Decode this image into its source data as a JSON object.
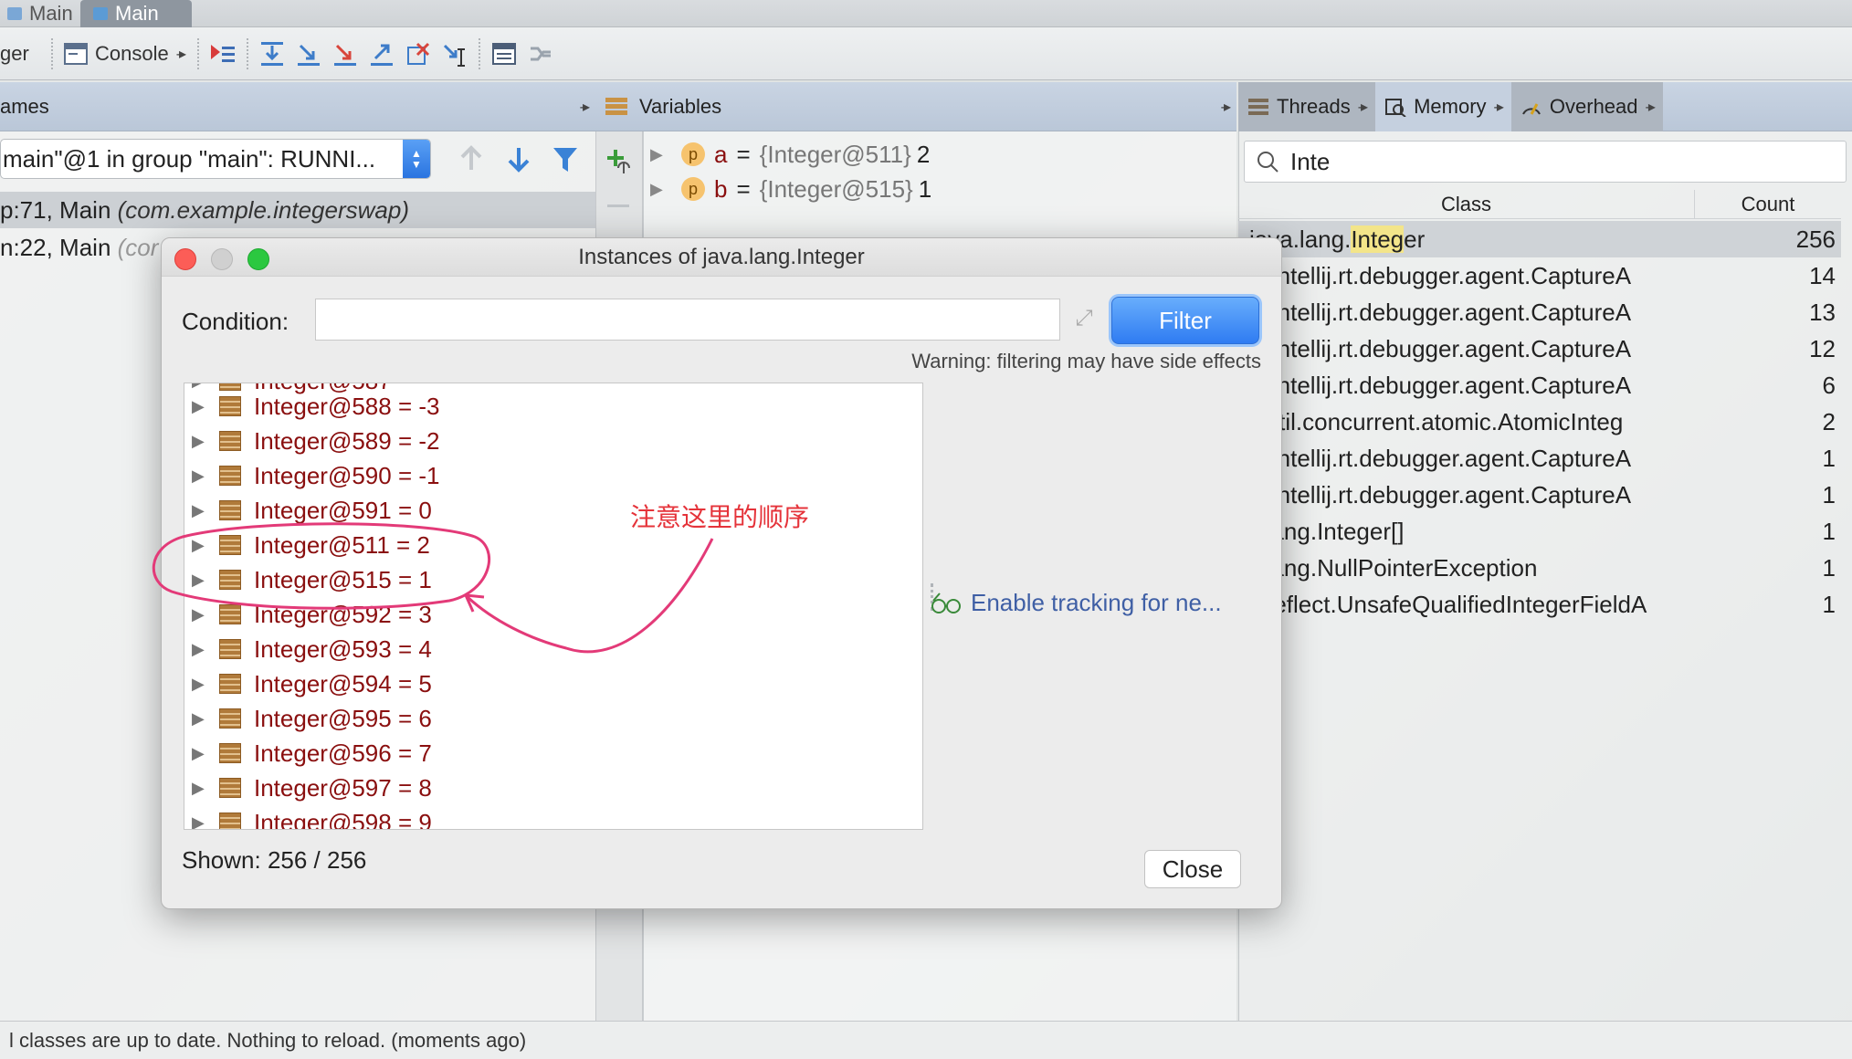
{
  "top_tabs": [
    {
      "label": "Main"
    },
    {
      "label": "Main"
    }
  ],
  "toolbar": {
    "debugger_label": "ger",
    "console_label": "Console"
  },
  "frames": {
    "header": "ames",
    "thread_select": "main\"@1 in group \"main\": RUNNI...",
    "rows": [
      {
        "method": "p:71, Main",
        "pkg": "(com.example.integerswap)"
      },
      {
        "method": "n:22, Main",
        "pkg": "(cor"
      }
    ]
  },
  "variables": {
    "header": "Variables",
    "rows": [
      {
        "badge": "p",
        "name": "a",
        "type": "{Integer@511}",
        "value": "2"
      },
      {
        "badge": "p",
        "name": "b",
        "type": "{Integer@515}",
        "value": "1"
      }
    ]
  },
  "memory": {
    "tabs": [
      "Threads",
      "Memory",
      "Overhead"
    ],
    "search_value": "Inte",
    "columns": [
      "Class",
      "Count"
    ],
    "rows": [
      {
        "pre": "java.lang.",
        "hl": "Integ",
        "post": "er",
        "count": "256"
      },
      {
        "cls": "m.intellij.rt.debugger.agent.CaptureA",
        "count": "14"
      },
      {
        "cls": "m.intellij.rt.debugger.agent.CaptureA",
        "count": "13"
      },
      {
        "cls": "m.intellij.rt.debugger.agent.CaptureA",
        "count": "12"
      },
      {
        "cls": "m.intellij.rt.debugger.agent.CaptureA",
        "count": "6"
      },
      {
        "cls": "a.util.concurrent.atomic.AtomicInteg",
        "count": "2"
      },
      {
        "cls": "m.intellij.rt.debugger.agent.CaptureA",
        "count": "1"
      },
      {
        "cls": "m.intellij.rt.debugger.agent.CaptureA",
        "count": "1"
      },
      {
        "cls": "a.lang.Integer[]",
        "count": "1"
      },
      {
        "cls": "a.lang.NullPointerException",
        "count": "1"
      },
      {
        "cls": "n.reflect.UnsafeQualifiedIntegerFieldA",
        "count": "1"
      }
    ]
  },
  "dialog": {
    "title": "Instances of java.lang.Integer",
    "condition_label": "Condition:",
    "condition_value": "",
    "filter_label": "Filter",
    "warning": "Warning: filtering may have side effects",
    "instances": [
      "Integer@588 = -3",
      "Integer@589 = -2",
      "Integer@590 = -1",
      "Integer@591 = 0",
      "Integer@511 = 2",
      "Integer@515 = 1",
      "Integer@592 = 3",
      "Integer@593 = 4",
      "Integer@594 = 5",
      "Integer@595 = 6",
      "Integer@596 = 7",
      "Integer@597 = 8",
      "Integer@598 = 9"
    ],
    "enable_tracking": "Enable tracking for ne...",
    "shown": "Shown: 256 / 256",
    "close_label": "Close"
  },
  "annotation": {
    "text": "注意这里的顺序",
    "color": "#e5333a"
  },
  "status": {
    "text": "l classes are up to date. Nothing to reload. (moments ago)"
  }
}
